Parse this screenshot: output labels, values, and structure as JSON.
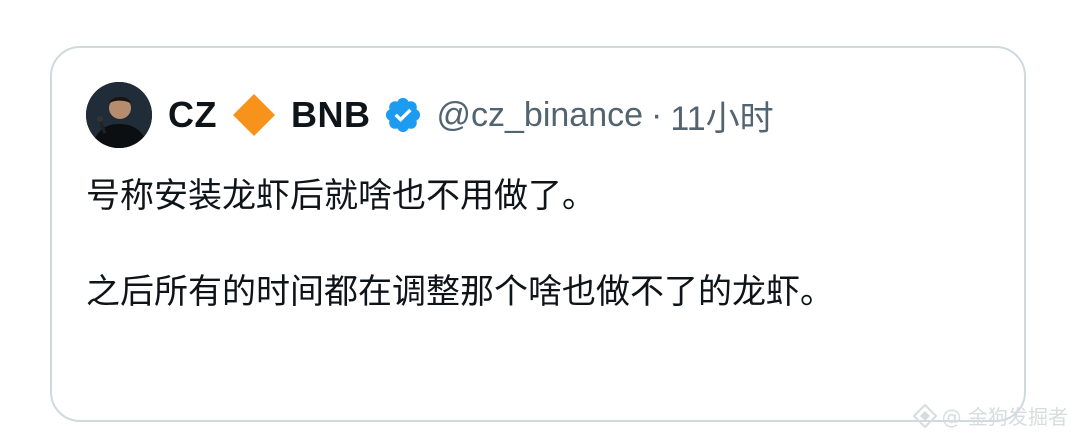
{
  "tweet": {
    "author": {
      "name_part_1": "CZ",
      "icon": "orange-diamond-icon",
      "name_part_2": "BNB",
      "verified_icon": "verified-badge-icon",
      "handle": "@cz_binance",
      "separator": "·",
      "time": "11小时"
    },
    "paragraphs": [
      "号称安装龙虾后就啥也不用做了。",
      "之后所有的时间都在调整那个啥也做不了的龙虾。"
    ]
  },
  "watermark": {
    "text": "@ 金狗发掘者",
    "icon": "diamond-logo-icon"
  },
  "colors": {
    "text": "#0f1419",
    "muted": "#536471",
    "verified": "#1d9bf0",
    "diamond": "#f7931a",
    "border": "#cfd9de",
    "watermark": "#d8dcdf"
  }
}
